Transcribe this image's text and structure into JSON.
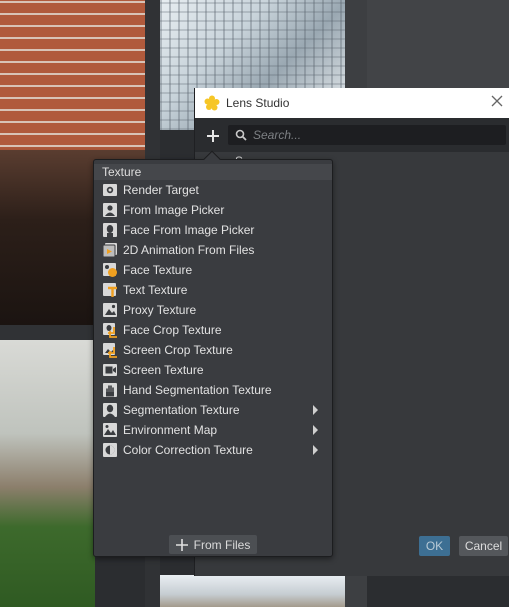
{
  "dialog": {
    "title": "Lens Studio",
    "search_placeholder": "Search...",
    "partial_text_1": "S",
    "partial_text_2": "exture",
    "ok_label": "OK",
    "cancel_label": "Cancel"
  },
  "menu": {
    "header": "Texture",
    "items": [
      {
        "label": "Render Target",
        "icon": "render-target-icon"
      },
      {
        "label": "From Image Picker",
        "icon": "image-picker-icon"
      },
      {
        "label": "Face From Image Picker",
        "icon": "face-picker-icon"
      },
      {
        "label": "2D Animation From Files",
        "icon": "animation-icon"
      },
      {
        "label": "Face Texture",
        "icon": "face-texture-icon"
      },
      {
        "label": "Text Texture",
        "icon": "text-texture-icon"
      },
      {
        "label": "Proxy Texture",
        "icon": "proxy-texture-icon"
      },
      {
        "label": "Face Crop Texture",
        "icon": "face-crop-icon"
      },
      {
        "label": "Screen Crop Texture",
        "icon": "screen-crop-icon"
      },
      {
        "label": "Screen Texture",
        "icon": "screen-texture-icon"
      },
      {
        "label": "Hand Segmentation Texture",
        "icon": "hand-segmentation-icon"
      },
      {
        "label": "Segmentation Texture",
        "icon": "segmentation-icon",
        "submenu": true
      },
      {
        "label": "Environment Map",
        "icon": "environment-map-icon",
        "submenu": true
      },
      {
        "label": "Color Correction Texture",
        "icon": "color-correction-icon",
        "submenu": true
      }
    ],
    "from_files_label": "From Files"
  },
  "colors": {
    "menu_bg": "#3a3c40",
    "accent_orange": "#f0a020",
    "ok_blue": "#3d6f93"
  }
}
